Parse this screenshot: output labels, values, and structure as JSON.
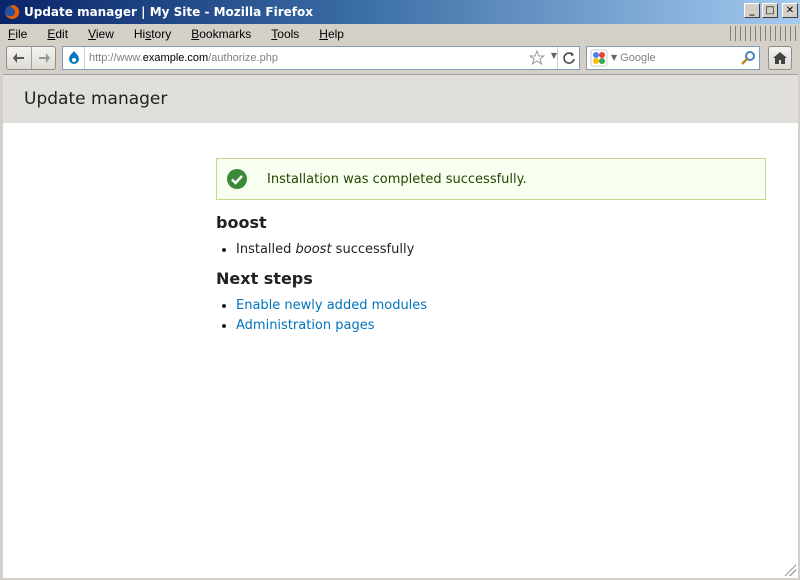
{
  "window": {
    "title": "Update manager | My Site - Mozilla Firefox",
    "controls": {
      "minimize": "_",
      "maximize": "□",
      "close": "✕"
    }
  },
  "menubar": {
    "items": [
      {
        "label": "File",
        "accel": "F",
        "rest": "ile"
      },
      {
        "label": "Edit",
        "accel": "E",
        "rest": "dit"
      },
      {
        "label": "View",
        "accel": "V",
        "rest": "iew"
      },
      {
        "label": "History",
        "accel": "",
        "pre": "Hi",
        "accel2": "s",
        "rest": "tory"
      },
      {
        "label": "Bookmarks",
        "accel": "B",
        "rest": "ookmarks"
      },
      {
        "label": "Tools",
        "accel": "T",
        "rest": "ools"
      },
      {
        "label": "Help",
        "accel": "H",
        "rest": "elp"
      }
    ]
  },
  "toolbar": {
    "url_prefix": "http://www.",
    "url_domain": "example.com",
    "url_path": "/authorize.php",
    "search_placeholder": "Google",
    "icons": [
      "back-arrow-icon",
      "forward-arrow-icon",
      "drupal-site-icon",
      "star-icon",
      "reload-icon",
      "google-icon",
      "search-magnifier-icon",
      "home-icon"
    ]
  },
  "page": {
    "header_title": "Update manager",
    "status_message": "Installation was completed successfully.",
    "status_color": "#3a8a3a",
    "project_heading": "boost",
    "installed_prefix": "Installed ",
    "installed_name": "boost",
    "installed_suffix": " successfully",
    "next_steps_heading": "Next steps",
    "links": [
      "Enable newly added modules",
      "Administration pages"
    ],
    "link_color": "#0074bd"
  }
}
